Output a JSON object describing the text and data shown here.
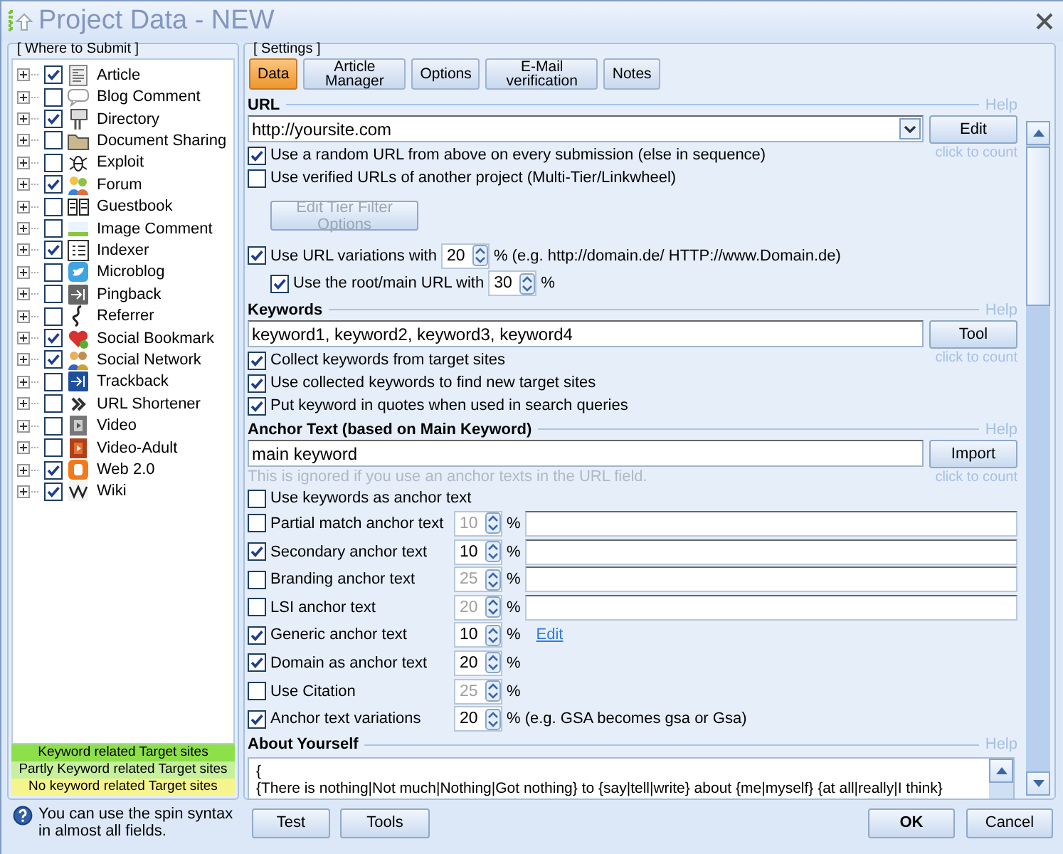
{
  "window": {
    "title": "Project Data - NEW"
  },
  "where_to_submit": {
    "title": "[ Where to Submit ]",
    "items": [
      {
        "label": "Article",
        "checked": true,
        "expanded": false
      },
      {
        "label": "Blog Comment",
        "checked": false,
        "expanded": false
      },
      {
        "label": "Directory",
        "checked": true,
        "expanded": false
      },
      {
        "label": "Document Sharing",
        "checked": false,
        "expanded": false
      },
      {
        "label": "Exploit",
        "checked": false,
        "expanded": false
      },
      {
        "label": "Forum",
        "checked": true,
        "expanded": false
      },
      {
        "label": "Guestbook",
        "checked": false,
        "expanded": false
      },
      {
        "label": "Image Comment",
        "checked": false,
        "expanded": false
      },
      {
        "label": "Indexer",
        "checked": true,
        "expanded": false
      },
      {
        "label": "Microblog",
        "checked": false,
        "expanded": false
      },
      {
        "label": "Pingback",
        "checked": false,
        "expanded": false
      },
      {
        "label": "Referrer",
        "checked": false,
        "expanded": false
      },
      {
        "label": "Social Bookmark",
        "checked": true,
        "expanded": false
      },
      {
        "label": "Social Network",
        "checked": true,
        "expanded": false
      },
      {
        "label": "Trackback",
        "checked": false,
        "expanded": false
      },
      {
        "label": "URL Shortener",
        "checked": false,
        "expanded": false
      },
      {
        "label": "Video",
        "checked": false,
        "expanded": false
      },
      {
        "label": "Video-Adult",
        "checked": false,
        "expanded": false
      },
      {
        "label": "Web 2.0",
        "checked": true,
        "expanded": false
      },
      {
        "label": "Wiki",
        "checked": true,
        "expanded": false
      }
    ],
    "legend": [
      {
        "label": "Keyword related Target sites",
        "color": "#8ee04a"
      },
      {
        "label": "Partly Keyword related Target sites",
        "color": "#c6f09c"
      },
      {
        "label": "No keyword related Target sites",
        "color": "#f6f48c"
      }
    ]
  },
  "help_note": "You can use the spin syntax in almost all fields.",
  "settings": {
    "title": "[ Settings ]",
    "tabs": [
      {
        "label": "Data",
        "selected": true
      },
      {
        "label": "Article Manager",
        "selected": false
      },
      {
        "label": "Options",
        "selected": false
      },
      {
        "label": "E-Mail verification",
        "selected": false
      },
      {
        "label": "Notes",
        "selected": false
      }
    ],
    "sections": [
      {
        "heading": "URL",
        "help": "Help",
        "rows": [
          {
            "kind": "combo",
            "value": "http://yoursite.com",
            "button": "Edit",
            "note": "click to count"
          },
          {
            "kind": "check",
            "label": "Use a random URL from above on every submission (else in sequence)",
            "checked": true
          },
          {
            "kind": "check",
            "label": "Use verified URLs of another project (Multi-Tier/Linkwheel)",
            "checked": false
          },
          {
            "kind": "button",
            "label": "Edit Tier Filter Options",
            "disabled": true
          },
          {
            "kind": "check",
            "label": "Use URL variations with",
            "checked": true,
            "spin": "20",
            "suffix": "% (e.g. http://domain.de/ HTTP://www.Domain.de)",
            "children": [
              {
                "kind": "check",
                "label": "Use the root/main URL with",
                "checked": true,
                "spin": "30",
                "suffix": "%"
              }
            ]
          }
        ]
      },
      {
        "heading": "Keywords",
        "help": "Help",
        "rows": [
          {
            "kind": "input",
            "value": "keyword1, keyword2, keyword3, keyword4",
            "button": "Tool",
            "note": "click to count"
          },
          {
            "kind": "check",
            "label": "Collect keywords from target sites",
            "checked": true
          },
          {
            "kind": "check",
            "label": "Use collected keywords to find new target sites",
            "checked": true
          },
          {
            "kind": "check",
            "label": "Put keyword in quotes when used in search queries",
            "checked": true
          }
        ]
      },
      {
        "heading": "Anchor Text (based on Main Keyword)",
        "help": "Help",
        "rows": [
          {
            "kind": "input",
            "value": "main keyword",
            "button": "Import",
            "note": "click to count"
          },
          {
            "kind": "hint",
            "text": "This is ignored if you use an anchor texts in the URL field."
          },
          {
            "kind": "check",
            "label": "Use keywords as anchor text",
            "checked": false
          },
          {
            "kind": "check-field",
            "label": "Partial match anchor text",
            "checked": false,
            "spin": "10",
            "suffix": "%"
          },
          {
            "kind": "check-field",
            "label": "Secondary anchor text",
            "checked": true,
            "spin": "10",
            "suffix": "%"
          },
          {
            "kind": "check-field",
            "label": "Branding anchor text",
            "checked": false,
            "spin": "25",
            "suffix": "%"
          },
          {
            "kind": "check-field",
            "label": "LSI anchor text",
            "checked": false,
            "spin": "20",
            "suffix": "%"
          },
          {
            "kind": "check",
            "label": "Generic anchor text",
            "checked": true,
            "spin": "10",
            "suffix": "%",
            "link": "Edit"
          },
          {
            "kind": "check",
            "label": "Domain as anchor text",
            "checked": true,
            "spin": "20",
            "suffix": "%"
          },
          {
            "kind": "check",
            "label": "Use Citation",
            "checked": false,
            "spin": "25",
            "suffix": "%"
          },
          {
            "kind": "check",
            "label": "Anchor text variations",
            "checked": true,
            "spin": "20",
            "suffix": "% (e.g. GSA becomes gsa or Gsa)"
          }
        ]
      },
      {
        "heading": "About Yourself",
        "help": "Help",
        "rows": [
          {
            "kind": "textarea",
            "lines": [
              "{",
              "{There is nothing|Not much|Nothing|Got nothing} to {say|tell|write} about {me|myself} {at all|really|I think}"
            ]
          }
        ]
      }
    ]
  },
  "buttons_left": [
    "Test",
    "Tools"
  ],
  "buttons_right": [
    "OK",
    "Cancel"
  ]
}
